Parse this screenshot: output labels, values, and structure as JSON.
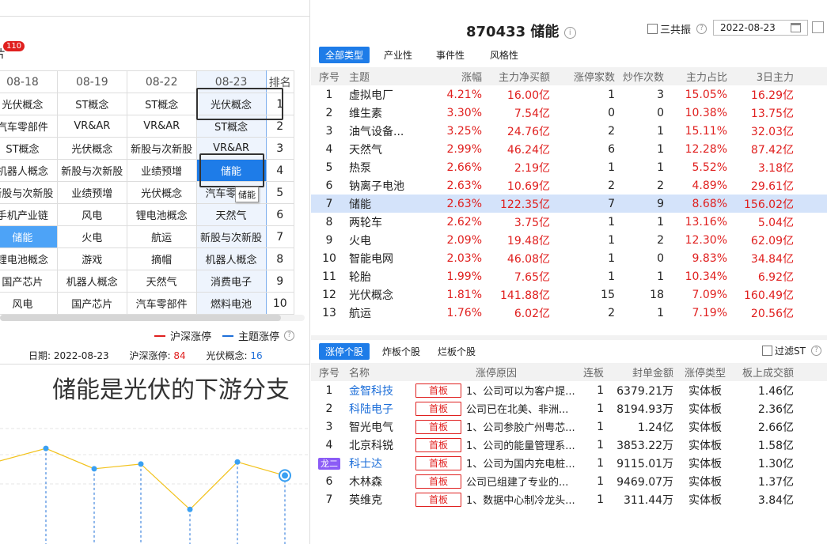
{
  "left": {
    "badge": "110",
    "top_char": "片",
    "headers": [
      "08-18",
      "08-19",
      "08-22",
      "08-23",
      "排名"
    ],
    "rows": [
      [
        "光伏概念",
        "ST概念",
        "ST概念",
        "光伏概念",
        "1"
      ],
      [
        "汽车零部件",
        "VR&AR",
        "VR&AR",
        "ST概念",
        "2"
      ],
      [
        "ST概念",
        "光伏概念",
        "新股与次新股",
        "VR&AR",
        "3"
      ],
      [
        "机器人概念",
        "新股与次新股",
        "业绩预增",
        "储能",
        "4"
      ],
      [
        "新股与次新股",
        "业绩预增",
        "光伏概念",
        "汽车零部件",
        "5"
      ],
      [
        "手机产业链",
        "风电",
        "锂电池概念",
        "天然气",
        "6"
      ],
      [
        "储能",
        "火电",
        "航运",
        "新股与次新股",
        "7"
      ],
      [
        "锂电池概念",
        "游戏",
        "摘帽",
        "机器人概念",
        "8"
      ],
      [
        "国产芯片",
        "机器人概念",
        "天然气",
        "消费电子",
        "9"
      ],
      [
        "风电",
        "国产芯片",
        "汽车零部件",
        "燃料电池",
        "10"
      ]
    ],
    "tooltip": "储能",
    "legend": {
      "a": "沪深涨停",
      "b": "主题涨停"
    },
    "info": {
      "date_label": "日期:",
      "date": "2022-08-23",
      "hs_label": "沪深涨停:",
      "hs": "84",
      "gf_label": "光伏概念:",
      "gf": "16"
    },
    "big_text": "储能是光伏的下游分支",
    "colors": {
      "hs_line": "#e0201f",
      "topic_line": "#1e6fd9"
    }
  },
  "chart_data": {
    "type": "line",
    "series": [
      {
        "name": "",
        "values": [
          10,
          12,
          9,
          9.7,
          3,
          10,
          8
        ]
      }
    ]
  },
  "right": {
    "title": "870433 储能",
    "sgz_label": "三共振",
    "date": "2022-08-23",
    "tabs": [
      "全部类型",
      "产业性",
      "事件性",
      "风格性"
    ],
    "headers": [
      "序号",
      "主题",
      "涨幅",
      "主力净买额",
      "涨停家数",
      "炒作次数",
      "主力占比",
      "3日主力"
    ],
    "rows": [
      [
        "1",
        "虚拟电厂",
        "4.21%",
        "16.00亿",
        "1",
        "3",
        "15.05%",
        "16.29亿"
      ],
      [
        "2",
        "维生素",
        "3.30%",
        "7.54亿",
        "0",
        "0",
        "10.38%",
        "13.75亿"
      ],
      [
        "3",
        "油气设备...",
        "3.25%",
        "24.76亿",
        "2",
        "1",
        "15.11%",
        "32.03亿"
      ],
      [
        "4",
        "天然气",
        "2.99%",
        "46.24亿",
        "6",
        "1",
        "12.28%",
        "87.42亿"
      ],
      [
        "5",
        "热泵",
        "2.66%",
        "2.19亿",
        "1",
        "1",
        "5.52%",
        "3.18亿"
      ],
      [
        "6",
        "钠离子电池",
        "2.63%",
        "10.69亿",
        "2",
        "2",
        "4.89%",
        "29.61亿"
      ],
      [
        "7",
        "储能",
        "2.63%",
        "122.35亿",
        "7",
        "9",
        "8.68%",
        "156.02亿"
      ],
      [
        "8",
        "两轮车",
        "2.62%",
        "3.75亿",
        "1",
        "1",
        "13.16%",
        "5.04亿"
      ],
      [
        "9",
        "火电",
        "2.09%",
        "19.48亿",
        "1",
        "2",
        "12.30%",
        "62.09亿"
      ],
      [
        "10",
        "智能电网",
        "2.03%",
        "46.08亿",
        "1",
        "0",
        "9.83%",
        "34.84亿"
      ],
      [
        "11",
        "轮胎",
        "1.99%",
        "7.65亿",
        "1",
        "1",
        "10.34%",
        "6.92亿"
      ],
      [
        "12",
        "光伏概念",
        "1.81%",
        "141.88亿",
        "15",
        "18",
        "7.09%",
        "160.49亿"
      ],
      [
        "13",
        "航运",
        "1.76%",
        "6.02亿",
        "2",
        "1",
        "7.19%",
        "20.56亿"
      ]
    ],
    "tabs2": [
      "涨停个股",
      "炸板个股",
      "烂板个股"
    ],
    "filter_label": "过滤ST",
    "headers2": [
      "序号",
      "名称",
      "涨停原因",
      "连板",
      "封单金额",
      "涨停类型",
      "板上成交额"
    ],
    "stocks": [
      [
        "1",
        "金智科技",
        "首板",
        "1、公司可以为客户提...",
        "1",
        "6379.21万",
        "实体板",
        "1.46亿"
      ],
      [
        "2",
        "科陆电子",
        "首板",
        "公司已在北美、非洲...",
        "1",
        "8194.93万",
        "实体板",
        "2.36亿"
      ],
      [
        "3",
        "智光电气",
        "首板",
        "1、公司参胶广州粤芯...",
        "1",
        "1.24亿",
        "实体板",
        "2.66亿"
      ],
      [
        "4",
        "北京科锐",
        "首板",
        "1、公司的能量管理系...",
        "1",
        "3853.22万",
        "实体板",
        "1.58亿"
      ],
      [
        "龙二",
        "科士达",
        "首板",
        "1、公司为国内充电桩...",
        "1",
        "9115.01万",
        "实体板",
        "1.30亿"
      ],
      [
        "6",
        "木林森",
        "首板",
        "公司已组建了专业的...",
        "1",
        "9469.07万",
        "实体板",
        "1.37亿"
      ],
      [
        "7",
        "英维克",
        "首板",
        "1、数据中心制冷龙头...",
        "1",
        "311.44万",
        "实体板",
        "3.84亿"
      ]
    ]
  }
}
